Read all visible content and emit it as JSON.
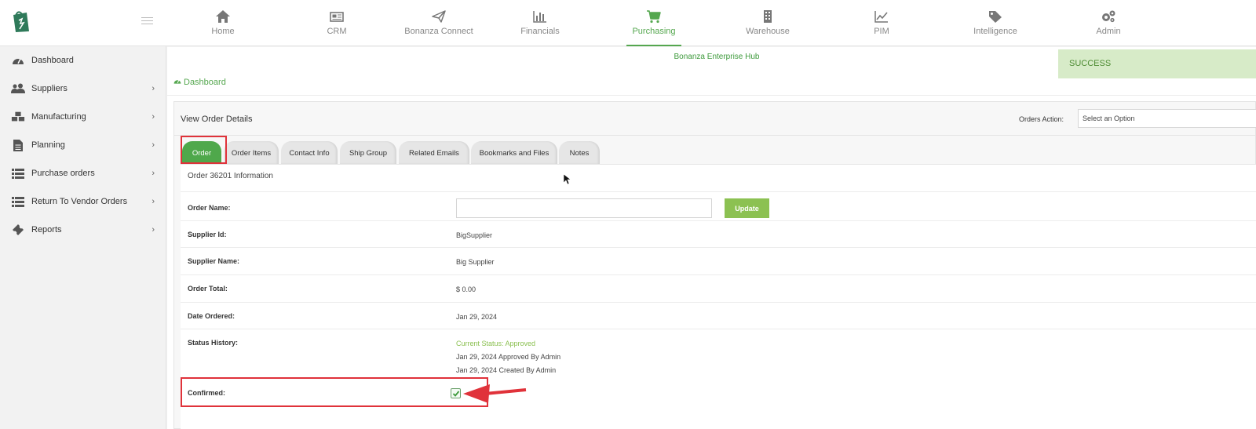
{
  "topnav": {
    "items": [
      {
        "label": "Home",
        "icon": "home-icon"
      },
      {
        "label": "CRM",
        "icon": "newspaper-icon"
      },
      {
        "label": "Bonanza Connect",
        "icon": "paper-plane-icon"
      },
      {
        "label": "Financials",
        "icon": "bar-chart-icon"
      },
      {
        "label": "Purchasing",
        "icon": "shopping-cart-icon",
        "active": true
      },
      {
        "label": "Warehouse",
        "icon": "building-icon"
      },
      {
        "label": "PIM",
        "icon": "line-chart-icon"
      },
      {
        "label": "Intelligence",
        "icon": "tags-icon"
      },
      {
        "label": "Admin",
        "icon": "gears-icon"
      }
    ]
  },
  "sidebar": {
    "items": [
      {
        "label": "Dashboard",
        "icon": "dashboard-icon",
        "has_children": false
      },
      {
        "label": "Suppliers",
        "icon": "users-icon",
        "has_children": true
      },
      {
        "label": "Manufacturing",
        "icon": "cubes-icon",
        "has_children": true
      },
      {
        "label": "Planning",
        "icon": "file-icon",
        "has_children": true
      },
      {
        "label": "Purchase orders",
        "icon": "list-icon",
        "has_children": true
      },
      {
        "label": "Return To Vendor Orders",
        "icon": "list-icon",
        "has_children": true
      },
      {
        "label": "Reports",
        "icon": "ticket-icon",
        "has_children": true
      }
    ]
  },
  "header": {
    "hub_title": "Bonanza Enterprise Hub",
    "success_message": "SUCCESS"
  },
  "breadcrumb": {
    "label": "Dashboard"
  },
  "panel": {
    "title": "View Order Details",
    "orders_action_label": "Orders Action:",
    "orders_action_value": "Select an Option"
  },
  "tabs": [
    {
      "label": "Order",
      "active": true
    },
    {
      "label": "Order Items"
    },
    {
      "label": "Contact Info"
    },
    {
      "label": "Ship Group"
    },
    {
      "label": "Related Emails"
    },
    {
      "label": "Bookmarks and Files"
    },
    {
      "label": "Notes"
    }
  ],
  "order": {
    "section_title": "Order 36201 Information",
    "order_name_label": "Order Name:",
    "order_name_value": "",
    "update_label": "Update",
    "supplier_id_label": "Supplier Id:",
    "supplier_id": "BigSupplier",
    "supplier_name_label": "Supplier Name:",
    "supplier_name": "Big Supplier",
    "order_total_label": "Order Total:",
    "order_total": "$ 0.00",
    "date_ordered_label": "Date Ordered:",
    "date_ordered": "Jan 29, 2024",
    "status_history_label": "Status History:",
    "status_current": "Current Status: Approved",
    "status_history": [
      "Jan 29, 2024 Approved By Admin",
      "Jan 29, 2024 Created By Admin"
    ],
    "confirmed_label": "Confirmed:",
    "confirmed": true
  },
  "colors": {
    "accent": "#55a74f",
    "update_button": "#8cc152",
    "success_bg": "#d7ebc8",
    "highlight": "#e0323a"
  }
}
